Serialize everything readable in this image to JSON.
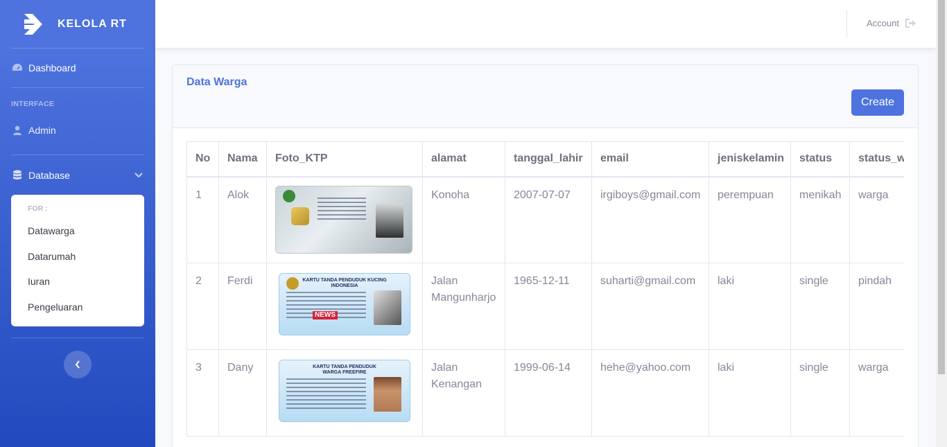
{
  "brand": {
    "name": "KELOLA RT"
  },
  "sidebar": {
    "dashboard": "Dashboard",
    "heading_interface": "INTERFACE",
    "admin": "Admin",
    "database": "Database",
    "collapse_header": "FOR :",
    "collapse_items": [
      "Datawarga",
      "Datarumah",
      "Iuran",
      "Pengeluaran"
    ]
  },
  "topbar": {
    "account": "Account"
  },
  "card": {
    "title": "Data Warga",
    "create_label": "Create"
  },
  "table": {
    "headers": [
      "No",
      "Nama",
      "Foto_KTP",
      "alamat",
      "tanggal_lahir",
      "email",
      "jeniskelamin",
      "status",
      "status_w"
    ],
    "rows": [
      {
        "no": "1",
        "nama": "Alok",
        "alamat": "Konoha",
        "tanggal_lahir": "2007-07-07",
        "email": "irgiboys@gmail.com",
        "jeniskelamin": "perempuan",
        "status": "menikah",
        "status_warga": "warga"
      },
      {
        "no": "2",
        "nama": "Ferdi",
        "alamat": "Jalan Mangunharjo",
        "tanggal_lahir": "1965-12-11",
        "email": "suharti@gmail.com",
        "jeniskelamin": "laki",
        "status": "single",
        "status_warga": "pindah",
        "ktp_title": "KARTU TANDA PENDUDUK KUCING INDONESIA",
        "ktp_badge": "NEWS"
      },
      {
        "no": "3",
        "nama": "Dany",
        "alamat": "Jalan Kenangan",
        "tanggal_lahir": "1999-06-14",
        "email": "hehe@yahoo.com",
        "jeniskelamin": "laki",
        "status": "single",
        "status_warga": "warga",
        "ktp_title": "KARTU TANDA PENDUDUK WARGA FREEFIRE"
      }
    ]
  },
  "colors": {
    "primary": "#4e73df",
    "primary_dark": "#224abe",
    "text_muted": "#858796"
  }
}
